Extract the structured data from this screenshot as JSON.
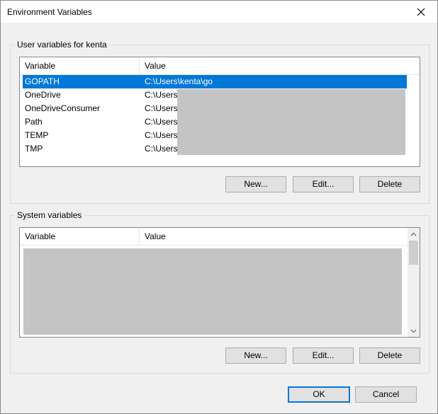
{
  "window": {
    "title": "Environment Variables"
  },
  "user_group": {
    "label": "User variables for kenta",
    "columns": [
      "Variable",
      "Value"
    ],
    "rows": [
      {
        "variable": "GOPATH",
        "value": "C:\\Users\\kenta\\go",
        "selected": true
      },
      {
        "variable": "OneDrive",
        "value": "C:\\Users\\"
      },
      {
        "variable": "OneDriveConsumer",
        "value": "C:\\Users\\"
      },
      {
        "variable": "Path",
        "value": "C:\\Users\\"
      },
      {
        "variable": "TEMP",
        "value": "C:\\Users\\"
      },
      {
        "variable": "TMP",
        "value": "C:\\Users\\"
      }
    ],
    "buttons": {
      "new": "New...",
      "edit": "Edit...",
      "delete": "Delete"
    }
  },
  "system_group": {
    "label": "System variables",
    "columns": [
      "Variable",
      "Value"
    ],
    "buttons": {
      "new": "New...",
      "edit": "Edit...",
      "delete": "Delete"
    }
  },
  "footer": {
    "ok": "OK",
    "cancel": "Cancel"
  },
  "colors": {
    "selection": "#0078d7",
    "redaction": "#c4c4c4",
    "focus_border": "#0078d7"
  },
  "icons": {
    "close": "close-icon",
    "scroll_up": "chevron-up-icon",
    "scroll_down": "chevron-down-icon"
  }
}
